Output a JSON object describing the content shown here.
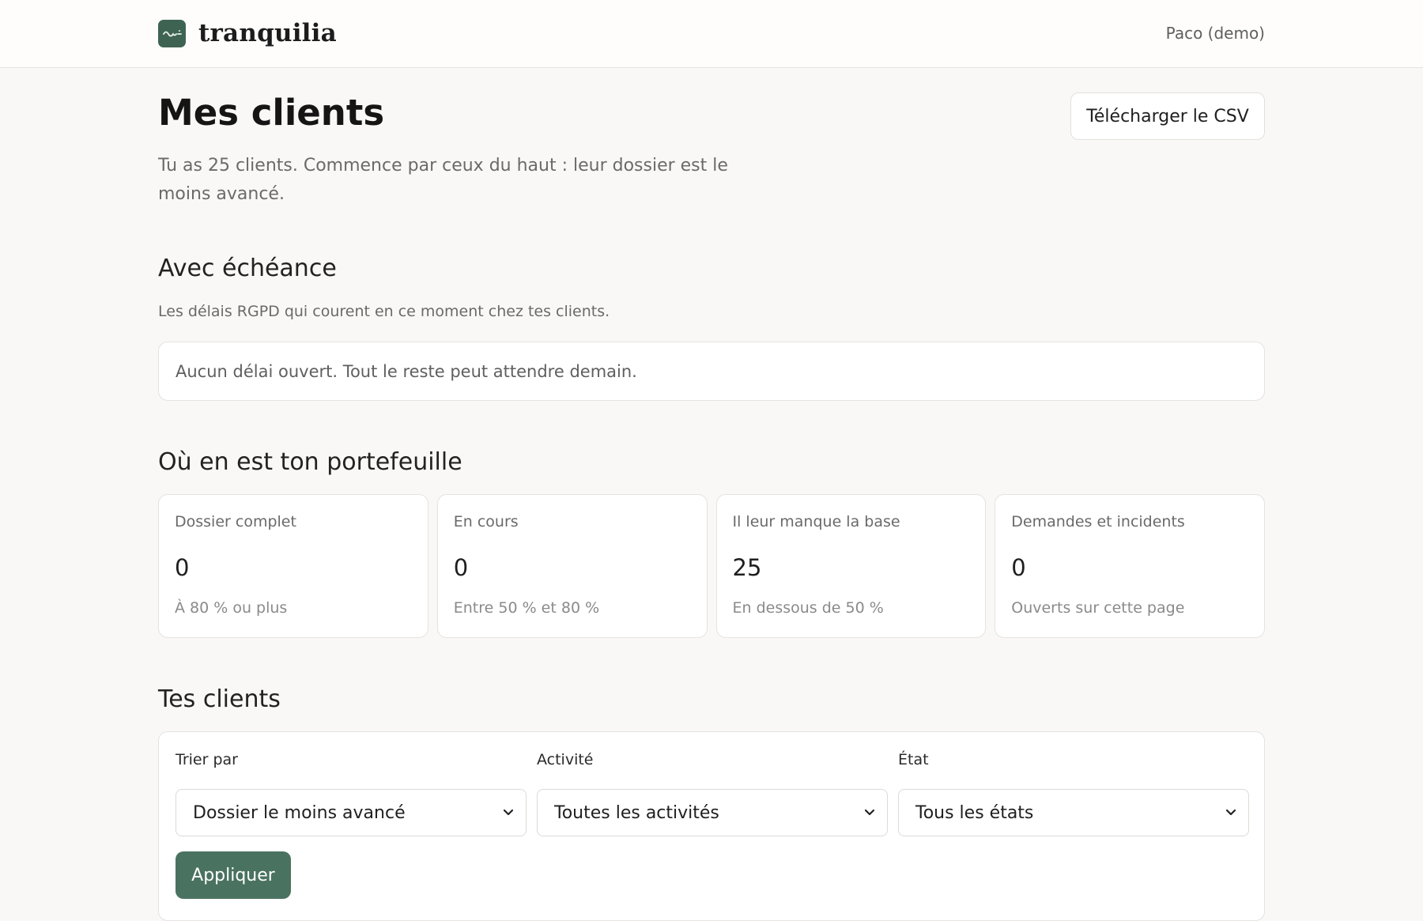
{
  "header": {
    "brand": "tranquilia",
    "user": "Paco (demo)"
  },
  "page": {
    "title": "Mes clients",
    "csv_button": "Télécharger le CSV",
    "intro": "Tu as 25 clients. Commence par ceux du haut : leur dossier est le moins avancé."
  },
  "deadlines": {
    "title": "Avec échéance",
    "subtitle": "Les délais RGPD qui courent en ce moment chez tes clients.",
    "empty_message": "Aucun délai ouvert. Tout le reste peut attendre demain."
  },
  "portfolio": {
    "title": "Où en est ton portefeuille",
    "cards": [
      {
        "label": "Dossier complet",
        "value": "0",
        "hint": "À 80 % ou plus"
      },
      {
        "label": "En cours",
        "value": "0",
        "hint": "Entre 50 % et 80 %"
      },
      {
        "label": "Il leur manque la base",
        "value": "25",
        "hint": "En dessous de 50 %"
      },
      {
        "label": "Demandes et incidents",
        "value": "0",
        "hint": "Ouverts sur cette page"
      }
    ]
  },
  "clients": {
    "title": "Tes clients",
    "filters": {
      "sort_label": "Trier par",
      "sort_value": "Dossier le moins avancé",
      "activity_label": "Activité",
      "activity_value": "Toutes les activités",
      "state_label": "État",
      "state_value": "Tous les états",
      "apply_button": "Appliquer"
    }
  },
  "colors": {
    "accent": "#4a7260",
    "brand": "#3f6353",
    "background": "#faf8f6"
  }
}
